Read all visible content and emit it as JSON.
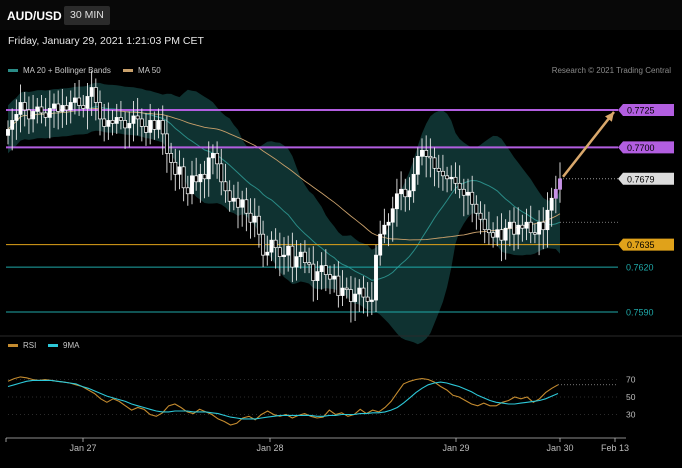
{
  "header": {
    "symbol": "AUD/USD",
    "timeframe": "30 MIN",
    "datetime": "Friday, January 29, 2021 1:21:03 PM CET"
  },
  "legend": {
    "ma20_label": "MA 20 + Bollinger Bands",
    "ma50_label": "MA 50",
    "rsi_label": "RSI",
    "rsi_ma_label": "9MA"
  },
  "credit": "Research © 2021 Trading Central",
  "colors": {
    "background": "#000000",
    "candle_up": "#ffffff",
    "candle_down": "#ffffff",
    "bollinger_fill": "#123b3a",
    "ma20": "#2a8b86",
    "ma50": "#c9a06b",
    "resistance": "#b25ee0",
    "support_gold": "#e0a21a",
    "support_teal": "#1fa8a8",
    "arrow": "#d9a86c",
    "rsi": "#c48b2f",
    "rsi_ma": "#2dc8d8"
  },
  "chart_data": [
    {
      "type": "candlestick",
      "title": "AUD/USD 30 MIN",
      "x_tick_labels": [
        "Jan 27",
        "Jan 28",
        "Jan 29",
        "Jan 30",
        "Feb 13"
      ],
      "y_range": [
        0.7578,
        0.7745
      ],
      "levels": [
        {
          "value": 0.7725,
          "label": "0.7725",
          "kind": "resistance",
          "style": "badge-purple"
        },
        {
          "value": 0.77,
          "label": "0.7700",
          "kind": "resistance",
          "style": "badge-purple"
        },
        {
          "value": 0.7679,
          "label": "0.7679",
          "kind": "last-price",
          "style": "badge-grey"
        },
        {
          "value": 0.7635,
          "label": "0.7635",
          "kind": "support",
          "style": "badge-gold"
        },
        {
          "value": 0.762,
          "label": "0.7620",
          "kind": "support",
          "style": "text-teal"
        },
        {
          "value": 0.759,
          "label": "0.7590",
          "kind": "support",
          "style": "text-teal"
        }
      ],
      "close_prices": [
        0.7712,
        0.7718,
        0.7722,
        0.773,
        0.7725,
        0.7719,
        0.7724,
        0.7727,
        0.7723,
        0.772,
        0.7726,
        0.7729,
        0.7724,
        0.7728,
        0.7725,
        0.773,
        0.7733,
        0.7728,
        0.7726,
        0.7734,
        0.774,
        0.773,
        0.7719,
        0.7714,
        0.7718,
        0.7716,
        0.772,
        0.7718,
        0.7713,
        0.7716,
        0.7721,
        0.7719,
        0.7714,
        0.771,
        0.7718,
        0.7712,
        0.7718,
        0.7709,
        0.7696,
        0.769,
        0.7682,
        0.7687,
        0.7673,
        0.7669,
        0.7681,
        0.7677,
        0.7682,
        0.7679,
        0.7693,
        0.7696,
        0.7689,
        0.7677,
        0.7671,
        0.7664,
        0.7666,
        0.766,
        0.7665,
        0.7656,
        0.765,
        0.7654,
        0.7642,
        0.7628,
        0.763,
        0.7638,
        0.7633,
        0.7627,
        0.7628,
        0.7634,
        0.762,
        0.7627,
        0.763,
        0.7623,
        0.7622,
        0.7611,
        0.7617,
        0.7621,
        0.7615,
        0.7612,
        0.7614,
        0.7601,
        0.7606,
        0.7605,
        0.7597,
        0.7602,
        0.7606,
        0.76,
        0.7597,
        0.7598,
        0.7628,
        0.7642,
        0.7648,
        0.765,
        0.7659,
        0.7669,
        0.7672,
        0.7667,
        0.7671,
        0.7682,
        0.7694,
        0.7698,
        0.7694,
        0.7693,
        0.7686,
        0.7684,
        0.7681,
        0.7679,
        0.768,
        0.7676,
        0.7672,
        0.7668,
        0.767,
        0.7662,
        0.7656,
        0.7652,
        0.7645,
        0.7643,
        0.764,
        0.7645,
        0.7638,
        0.7646,
        0.765,
        0.7642,
        0.7648,
        0.7646,
        0.765,
        0.7643,
        0.7642,
        0.765,
        0.7645,
        0.7658,
        0.7666,
        0.7672,
        0.7679
      ],
      "forecast_target": 0.7725
    },
    {
      "type": "line",
      "title": "RSI",
      "y_range": [
        10,
        90
      ],
      "y_ticks": [
        30,
        50,
        70
      ],
      "series": [
        {
          "name": "RSI",
          "values": [
            68,
            71,
            73,
            72,
            70,
            69,
            70,
            69,
            68,
            67,
            66,
            64,
            62,
            58,
            54,
            48,
            44,
            48,
            45,
            40,
            35,
            38,
            36,
            30,
            28,
            32,
            40,
            42,
            38,
            33,
            31,
            36,
            33,
            30,
            25,
            22,
            18,
            20,
            26,
            28,
            24,
            30,
            34,
            30,
            28,
            30,
            26,
            29,
            31,
            28,
            26,
            27,
            35,
            30,
            32,
            28,
            30,
            36,
            31,
            35,
            33,
            38,
            45,
            55,
            65,
            68,
            70,
            71,
            70,
            67,
            62,
            58,
            52,
            50,
            46,
            42,
            40,
            43,
            40,
            40,
            44,
            46,
            50,
            48,
            50,
            44,
            48,
            55,
            60,
            64
          ]
        },
        {
          "name": "9MA",
          "values": [
            62,
            64,
            66,
            68,
            69,
            69,
            69,
            69,
            68,
            67,
            66,
            65,
            62,
            60,
            57,
            54,
            51,
            49,
            47,
            45,
            42,
            40,
            38,
            36,
            34,
            33,
            33,
            34,
            34,
            34,
            33,
            33,
            33,
            32,
            31,
            29,
            27,
            26,
            25,
            25,
            25,
            26,
            27,
            28,
            29,
            29,
            29,
            29,
            29,
            29,
            28,
            28,
            29,
            29,
            30,
            30,
            30,
            31,
            31,
            32,
            32,
            33,
            35,
            38,
            43,
            49,
            55,
            60,
            64,
            66,
            67,
            66,
            64,
            62,
            59,
            56,
            52,
            49,
            46,
            44,
            43,
            42,
            42,
            43,
            44,
            45,
            46,
            48,
            51,
            54
          ]
        }
      ]
    }
  ]
}
